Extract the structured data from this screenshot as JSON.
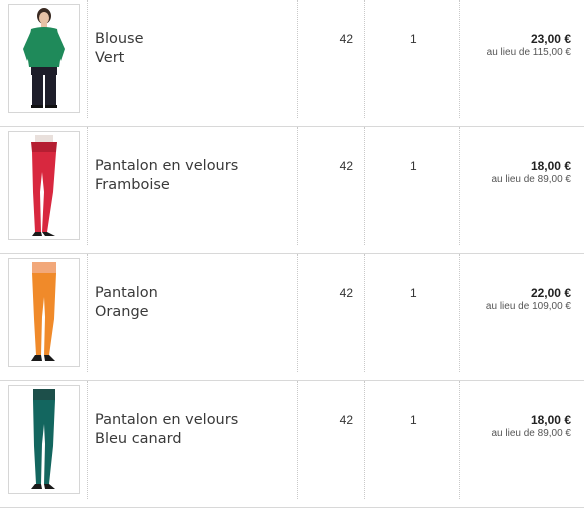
{
  "items": [
    {
      "name_line1": "Blouse",
      "name_line2": "Vert",
      "size": "42",
      "quantity": "1",
      "price": "23,00 €",
      "original_price": "au lieu de 115,00 €",
      "image": "green-blouse-photo",
      "color": "#1f8a5a"
    },
    {
      "name_line1": "Pantalon en velours",
      "name_line2": "Framboise",
      "size": "42",
      "quantity": "1",
      "price": "18,00 €",
      "original_price": "au lieu de 89,00 €",
      "image": "raspberry-pants-photo",
      "color": "#d8283f"
    },
    {
      "name_line1": "Pantalon",
      "name_line2": "Orange",
      "size": "42",
      "quantity": "1",
      "price": "22,00 €",
      "original_price": "au lieu de 109,00 €",
      "image": "orange-pants-photo",
      "color": "#f08a2a"
    },
    {
      "name_line1": "Pantalon en velours",
      "name_line2": "Bleu canard",
      "size": "42",
      "quantity": "1",
      "price": "18,00 €",
      "original_price": "au lieu de 89,00 €",
      "image": "teal-pants-photo",
      "color": "#13665f"
    }
  ]
}
